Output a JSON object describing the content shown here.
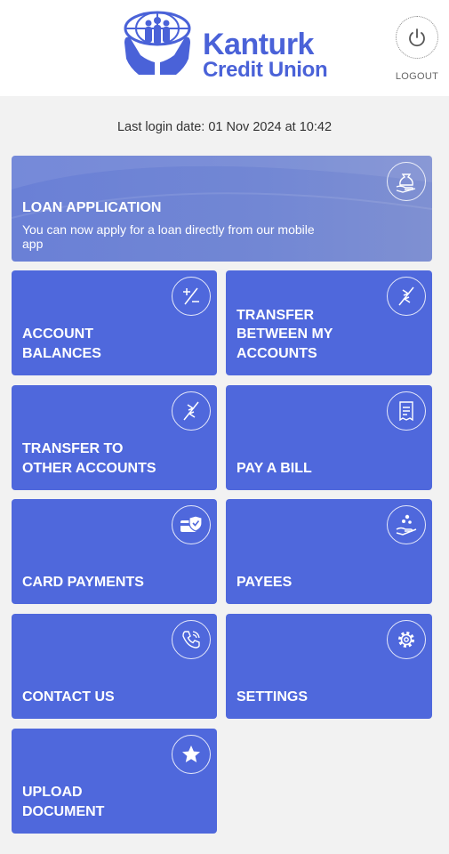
{
  "brand": {
    "name": "Kanturk",
    "sub": "Credit Union",
    "color": "#4a62d8"
  },
  "logout": {
    "label": "LOGOUT",
    "icon": "power-icon"
  },
  "last_login": "Last login date: 01 Nov 2024 at 10:42",
  "loan": {
    "title": "LOAN APPLICATION",
    "desc": "You can now apply for a loan directly from our mobile app",
    "icon": "money-hand-icon"
  },
  "tiles": [
    {
      "label": "ACCOUNT\nBALANCES",
      "icon": "plus-minus-icon"
    },
    {
      "label": "TRANSFER\nBETWEEN MY\nACCOUNTS",
      "icon": "transfer-arrows-icon"
    },
    {
      "label": "TRANSFER TO\nOTHER ACCOUNTS",
      "icon": "transfer-arrows-icon"
    },
    {
      "label": "PAY A BILL",
      "icon": "receipt-icon"
    },
    {
      "label": "CARD PAYMENTS",
      "icon": "card-shield-icon"
    },
    {
      "label": "PAYEES",
      "icon": "hand-coins-icon"
    },
    {
      "label": "CONTACT US",
      "icon": "phone-icon"
    },
    {
      "label": "SETTINGS",
      "icon": "gear-icon"
    },
    {
      "label": "UPLOAD\nDOCUMENT",
      "icon": "star-icon"
    }
  ],
  "colors": {
    "tile": "#4f68dc",
    "loan_tile": "#7287d4",
    "background": "#f2f2f2"
  }
}
